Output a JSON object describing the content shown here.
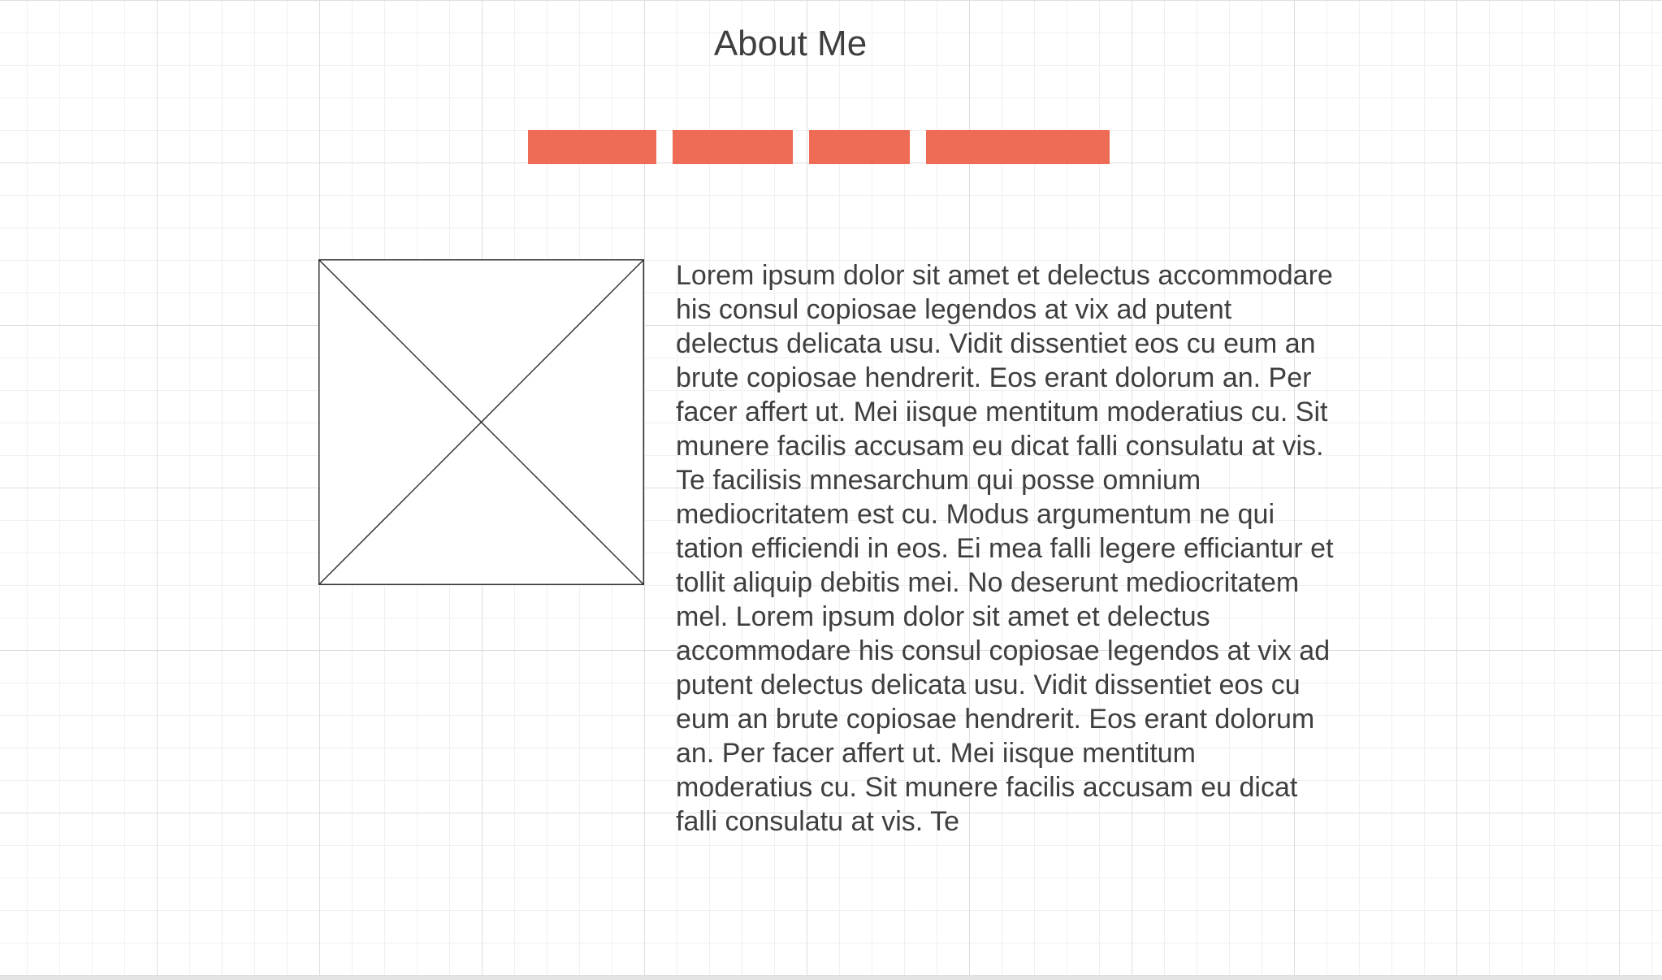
{
  "page": {
    "title": "About Me"
  },
  "nav": {
    "button_color": "#ee6c55",
    "items": [
      {
        "label": ""
      },
      {
        "label": ""
      },
      {
        "label": ""
      },
      {
        "label": ""
      }
    ]
  },
  "image": {
    "placeholder_name": "image-placeholder-icon"
  },
  "content": {
    "body_text": "Lorem ipsum dolor sit amet et delectus accommodare his consul copiosae legendos at vix ad putent delectus delicata usu. Vidit dissentiet eos cu eum an brute copiosae hendrerit. Eos erant dolorum an. Per facer affert ut. Mei iisque mentitum moderatius cu. Sit munere facilis accusam eu dicat falli consulatu at vis. Te facilisis mnesarchum qui posse omnium mediocritatem est cu. Modus argumentum ne qui tation efficiendi in eos. Ei mea falli legere efficiantur et tollit aliquip debitis mei. No deserunt mediocritatem mel. Lorem ipsum dolor sit amet et delectus accommodare his consul copiosae legendos at vix ad putent delectus delicata usu. Vidit dissentiet eos cu eum an brute copiosae hendrerit. Eos erant dolorum an. Per facer affert ut. Mei iisque mentitum moderatius cu. Sit munere facilis accusam eu dicat falli consulatu at vis. Te"
  },
  "colors": {
    "text": "#3f3f3f",
    "accent": "#ee6c55",
    "grid_major": "#dedede",
    "grid_minor": "#f0f0f0"
  }
}
